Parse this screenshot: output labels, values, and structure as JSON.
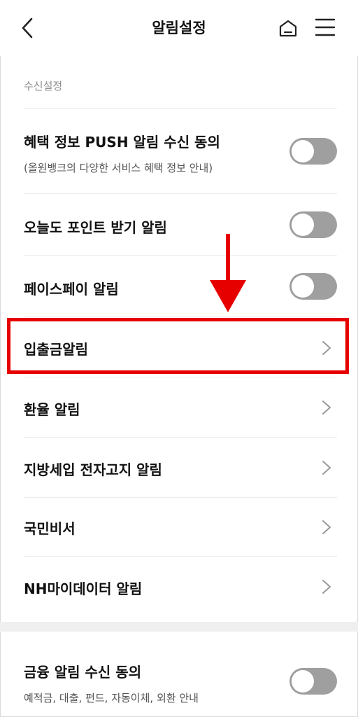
{
  "header": {
    "title": "알림설정",
    "back_icon": "chevron-left-icon",
    "home_icon": "home-icon",
    "menu_icon": "hamburger-menu-icon"
  },
  "section": {
    "label": "수신설정"
  },
  "items": [
    {
      "label": "혜택 정보 PUSH 알림 수신 동의",
      "sub": "(올원뱅크의 다양한 서비스 혜택 정보 안내)",
      "control": "toggle",
      "on": false
    },
    {
      "label": "오늘도 포인트 받기 알림",
      "control": "toggle",
      "on": false
    },
    {
      "label": "페이스페이 알림",
      "control": "toggle",
      "on": false
    },
    {
      "label": "입출금알림",
      "control": "chevron"
    },
    {
      "label": "환율 알림",
      "control": "chevron"
    },
    {
      "label": "지방세입 전자고지 알림",
      "control": "chevron"
    },
    {
      "label": "국민비서",
      "control": "chevron"
    },
    {
      "label": "NH마이데이터 알림",
      "control": "chevron"
    }
  ],
  "finance": {
    "label": "금융 알림 수신 동의",
    "sub": "예적금, 대출, 펀드, 자동이체, 외환 안내",
    "control": "toggle",
    "on": false
  },
  "annotation": {
    "highlight_color": "#e60000",
    "arrow_color": "#e60000"
  },
  "colors": {
    "toggle_off": "#9f9f9f",
    "chevron": "#9a9a9a"
  }
}
